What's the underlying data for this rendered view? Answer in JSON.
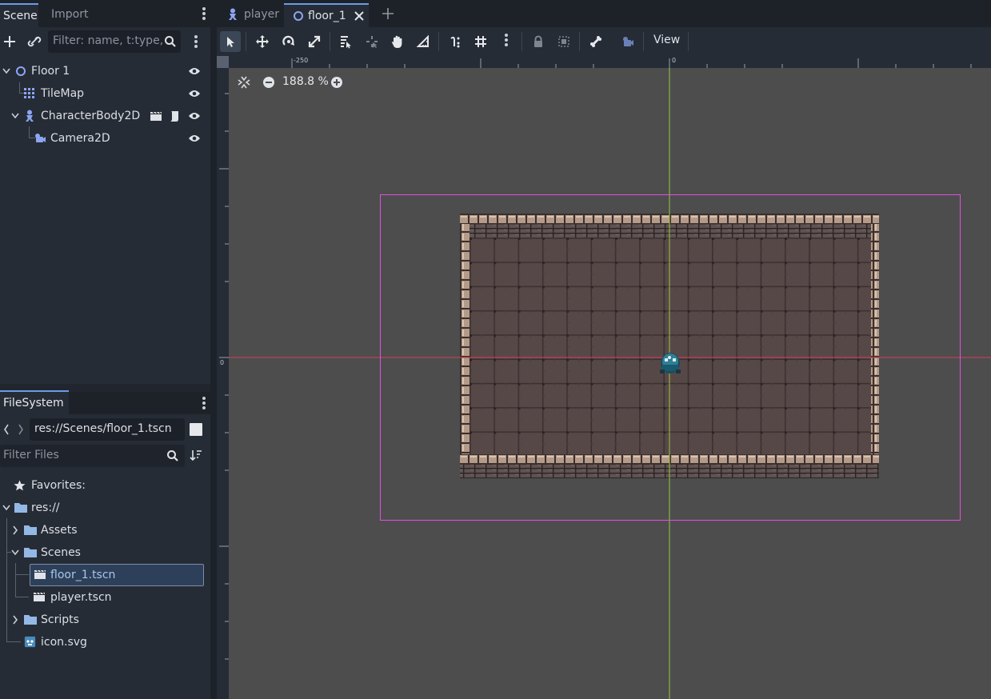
{
  "left_dock": {
    "tabs": [
      {
        "label": "Scene"
      },
      {
        "label": "Import"
      }
    ],
    "scene_filter_placeholder": "Filter: name, t:type,",
    "tree": [
      {
        "label": "Floor 1",
        "icon": "node2d-icon"
      },
      {
        "label": "TileMap",
        "icon": "tilemap-icon"
      },
      {
        "label": "CharacterBody2D",
        "icon": "characterbody2d-icon"
      },
      {
        "label": "Camera2D",
        "icon": "camera2d-icon"
      }
    ]
  },
  "filesystem": {
    "tab_label": "FileSystem",
    "path": "res://Scenes/floor_1.tscn",
    "filter_placeholder": "Filter Files",
    "items": [
      {
        "label": "Favorites:",
        "icon": "star-icon"
      },
      {
        "label": "res://",
        "icon": "folder-icon"
      },
      {
        "label": "Assets",
        "icon": "folder-icon"
      },
      {
        "label": "Scenes",
        "icon": "folder-icon"
      },
      {
        "label": "floor_1.tscn",
        "icon": "scene-file-icon",
        "selected": true
      },
      {
        "label": "player.tscn",
        "icon": "scene-file-icon"
      },
      {
        "label": "Scripts",
        "icon": "folder-icon"
      },
      {
        "label": "icon.svg",
        "icon": "godot-icon"
      }
    ]
  },
  "editor": {
    "scene_tabs": [
      {
        "label": "player",
        "active": false
      },
      {
        "label": "floor_1",
        "active": true
      }
    ],
    "toolbar": {
      "view_label": "View"
    },
    "zoom_label": "188.8 %",
    "rulers": {
      "top_labels": [
        "-250",
        "0"
      ],
      "left_labels": [
        "0"
      ]
    }
  },
  "colors": {
    "accent": "#699ce8",
    "panel": "#262c36",
    "background": "#1d2229",
    "viewport": "#4d4d4d",
    "axis_x": "#d9405a",
    "axis_y": "#94c93f",
    "camera_rect": "#e050e0"
  }
}
